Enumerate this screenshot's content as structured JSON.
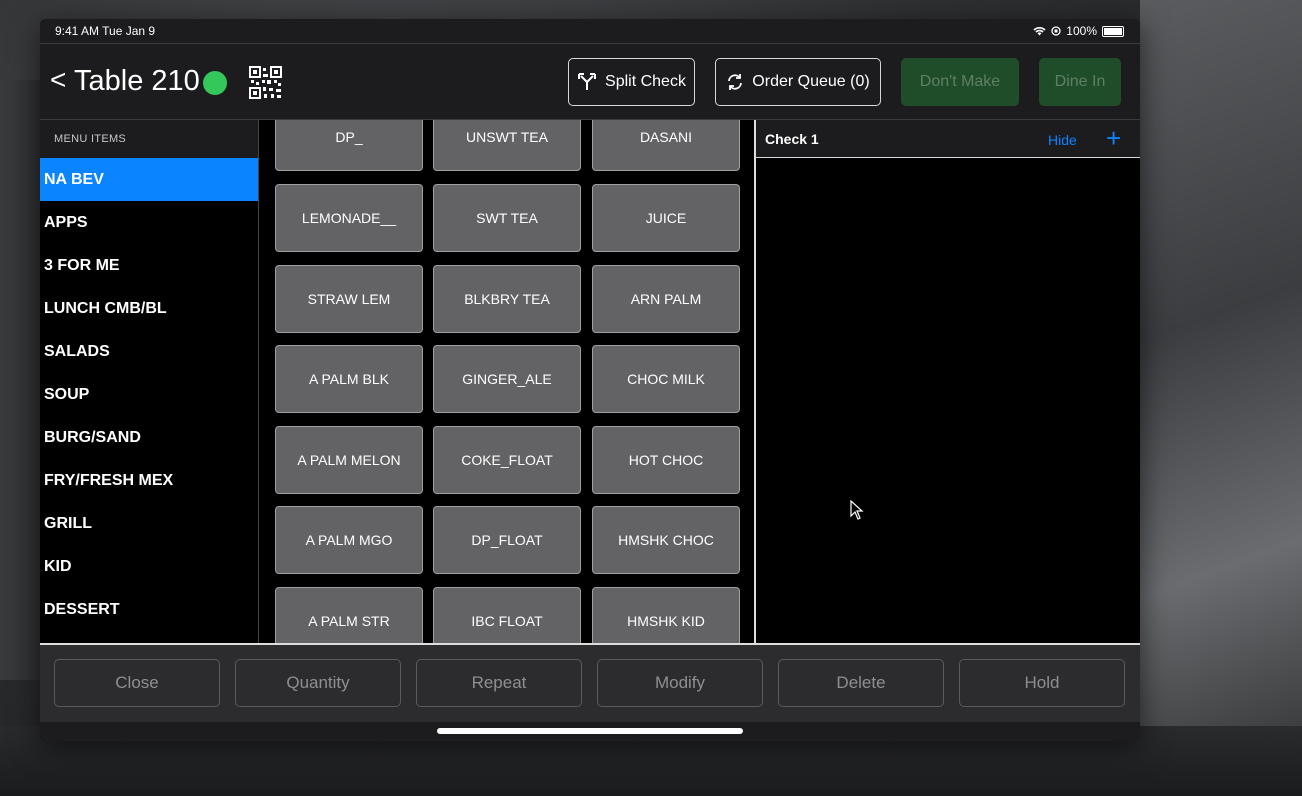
{
  "status": {
    "time": "9:41 AM  Tue Jan 9",
    "battery": "100%"
  },
  "header": {
    "back": "<",
    "title": "Table 210",
    "split_check": "Split Check",
    "order_queue": "Order Queue (0)",
    "dont_make": "Don't Make",
    "dine_in": "Dine In"
  },
  "sidebar": {
    "heading": "MENU ITEMS",
    "items": [
      "NA BEV",
      "APPS",
      "3 FOR ME",
      "LUNCH CMB/BL",
      "SALADS",
      "SOUP",
      "BURG/SAND",
      "FRY/FRESH MEX",
      "GRILL",
      "KID",
      "DESSERT"
    ]
  },
  "menu": {
    "rows": [
      [
        "DP_",
        "UNSWT TEA",
        "DASANI"
      ],
      [
        "LEMONADE__",
        "SWT TEA",
        "JUICE"
      ],
      [
        "STRAW LEM",
        "BLKBRY TEA",
        "ARN PALM"
      ],
      [
        "A PALM BLK",
        "GINGER_ALE",
        "CHOC MILK"
      ],
      [
        "A PALM MELON",
        "COKE_FLOAT",
        "HOT CHOC"
      ],
      [
        "A PALM MGO",
        "DP_FLOAT",
        "HMSHK CHOC"
      ],
      [
        "A PALM STR",
        "IBC FLOAT",
        "HMSHK KID"
      ]
    ]
  },
  "check": {
    "title": "Check 1",
    "hide": "Hide",
    "add": "+"
  },
  "actions": [
    "Close",
    "Quantity",
    "Repeat",
    "Modify",
    "Delete",
    "Hold"
  ],
  "colors": {
    "accent": "#0a84ff",
    "status_green": "#34c759",
    "disabled_green": "#1f4d2a"
  }
}
